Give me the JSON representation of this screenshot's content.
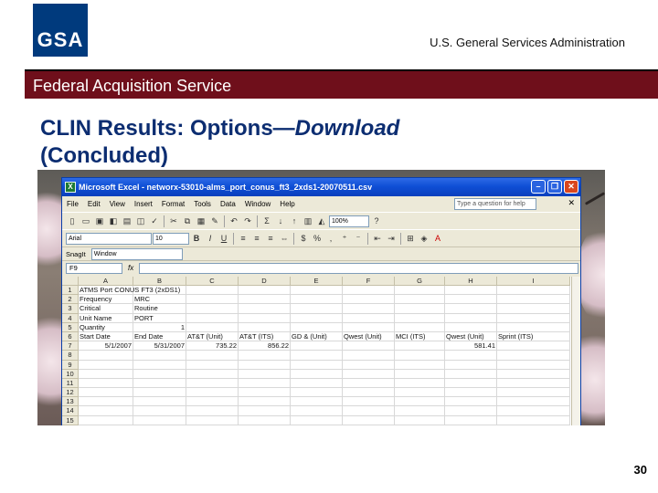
{
  "slide": {
    "logo_text": "GSA",
    "org_name": "U.S. General Services Administration",
    "banner": "Federal Acquisition Service",
    "title_plain": "CLIN Results:  Options—",
    "title_italic": "Download",
    "title_line2": "(Concluded)",
    "page_number": "30"
  },
  "excel": {
    "window_title": "Microsoft Excel - networx-53010-alms_port_conus_ft3_2xds1-20070511.csv",
    "menus": [
      "File",
      "Edit",
      "View",
      "Insert",
      "Format",
      "Tools",
      "Data",
      "Window",
      "Help"
    ],
    "help_placeholder": "Type a question for help",
    "zoom": "100%",
    "font_name": "Arial",
    "font_size": "10",
    "snagit_label": "SnagIt",
    "snagit_target": "Window",
    "name_box": "F9",
    "columns": [
      "A",
      "B",
      "C",
      "D",
      "E",
      "F",
      "G",
      "H",
      "I"
    ],
    "rows": [
      {
        "n": "1",
        "cells": [
          "ATMS Port CONUS FT3 (2xDS1)",
          "",
          "",
          "",
          "",
          "",
          "",
          "",
          ""
        ]
      },
      {
        "n": "2",
        "cells": [
          "Frequency",
          "MRC",
          "",
          "",
          "",
          "",
          "",
          "",
          ""
        ]
      },
      {
        "n": "3",
        "cells": [
          "Critical",
          "Routine",
          "",
          "",
          "",
          "",
          "",
          "",
          ""
        ]
      },
      {
        "n": "4",
        "cells": [
          "Unit Name",
          "PORT",
          "",
          "",
          "",
          "",
          "",
          "",
          ""
        ]
      },
      {
        "n": "5",
        "cells": [
          "Quantity",
          "1",
          "",
          "",
          "",
          "",
          "",
          "",
          ""
        ]
      },
      {
        "n": "6",
        "cells": [
          "Start Date",
          "End Date",
          "AT&T (Unit)",
          "AT&T (ITS)",
          "GD & (Unit)",
          "Qwest (Unit)",
          "MCI (ITS)",
          "Qwest (Unit)",
          "Sprint (ITS)"
        ]
      },
      {
        "n": "7",
        "cells": [
          "5/1/2007",
          "5/31/2007",
          "735.22",
          "856.22",
          "",
          "",
          "",
          "581.41",
          ""
        ]
      },
      {
        "n": "8",
        "cells": [
          "",
          "",
          "",
          "",
          "",
          "",
          "",
          "",
          ""
        ]
      },
      {
        "n": "9",
        "cells": [
          "",
          "",
          "",
          "",
          "",
          "",
          "",
          "",
          ""
        ]
      },
      {
        "n": "10",
        "cells": [
          "",
          "",
          "",
          "",
          "",
          "",
          "",
          "",
          ""
        ]
      },
      {
        "n": "11",
        "cells": [
          "",
          "",
          "",
          "",
          "",
          "",
          "",
          "",
          ""
        ]
      },
      {
        "n": "12",
        "cells": [
          "",
          "",
          "",
          "",
          "",
          "",
          "",
          "",
          ""
        ]
      },
      {
        "n": "13",
        "cells": [
          "",
          "",
          "",
          "",
          "",
          "",
          "",
          "",
          ""
        ]
      },
      {
        "n": "14",
        "cells": [
          "",
          "",
          "",
          "",
          "",
          "",
          "",
          "",
          ""
        ]
      },
      {
        "n": "15",
        "cells": [
          "",
          "",
          "",
          "",
          "",
          "",
          "",
          "",
          ""
        ]
      }
    ]
  }
}
